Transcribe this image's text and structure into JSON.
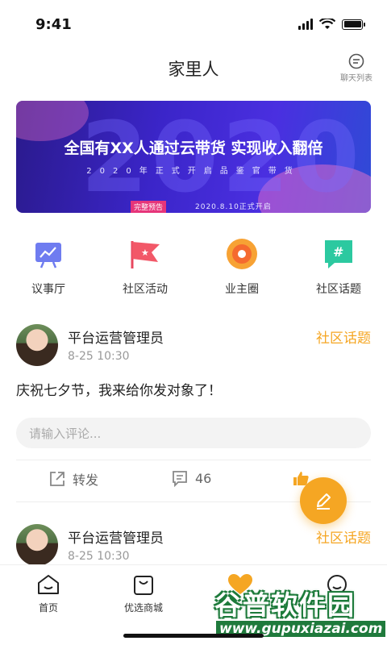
{
  "status_bar": {
    "time": "9:41"
  },
  "nav": {
    "title": "家里人",
    "chat_list_label": "聊天列表"
  },
  "banner": {
    "headline": "全国有XX人通过云带货 实现收入翻倍",
    "subline": "2020年正式开启品鉴官带货",
    "big_text": "2020",
    "tag": "完整预告",
    "date": "2020.8.10正式开启"
  },
  "quick_links": [
    {
      "label": "议事厅",
      "icon": "presentation-board-icon"
    },
    {
      "label": "社区活动",
      "icon": "flag-icon"
    },
    {
      "label": "业主圈",
      "icon": "circle-icon"
    },
    {
      "label": "社区话题",
      "icon": "hashtag-icon"
    }
  ],
  "posts": [
    {
      "author": "平台运营管理员",
      "time": "8-25 10:30",
      "topic": "社区话题",
      "text": "庆祝七夕节，我来给你发对象了！",
      "comment_placeholder": "请输入评论...",
      "share_label": "转发",
      "comment_count": "46"
    },
    {
      "author": "平台运营管理员",
      "time": "8-25 10:30",
      "topic": "社区话题"
    }
  ],
  "tabbar": [
    {
      "label": "首页",
      "icon": "home-icon"
    },
    {
      "label": "优选商城",
      "icon": "shopping-bag-icon"
    },
    {
      "label": "",
      "icon": "heart-icon"
    },
    {
      "label": "",
      "icon": "profile-icon"
    }
  ],
  "watermark": {
    "title": "谷普软件园",
    "url": "www.gupuxiazai.com"
  },
  "colors": {
    "accent": "#f5a623",
    "banner": "#3b25c9"
  }
}
